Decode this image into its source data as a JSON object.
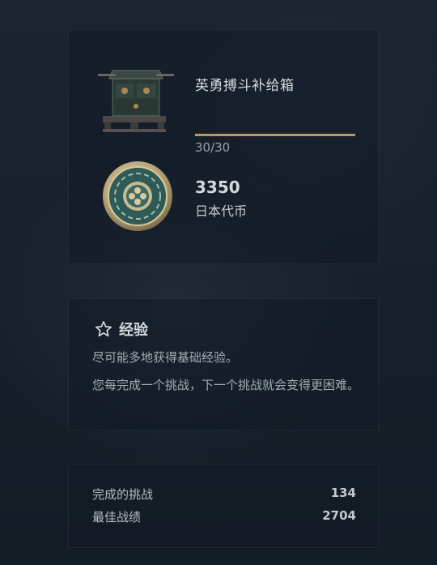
{
  "rewards": {
    "supply_box": {
      "title": "英勇搏斗补给箱",
      "progress_text": "30/30",
      "progress_fraction": 1.0,
      "icon": "supply-crate-icon"
    },
    "currency": {
      "amount": "3350",
      "name": "日本代币",
      "icon": "japanese-token-coin-icon"
    }
  },
  "experience": {
    "icon": "star-outline-icon",
    "title": "经验",
    "line1": "尽可能多地获得基础经验。",
    "line2": "您每完成一个挑战，下一个挑战就会变得更困难。"
  },
  "stats": {
    "rows": [
      {
        "label": "完成的挑战",
        "value": "134"
      },
      {
        "label": "最佳战绩",
        "value": "2704"
      }
    ]
  },
  "colors": {
    "accent_gold": "#b69a63",
    "background": "#18212c"
  }
}
